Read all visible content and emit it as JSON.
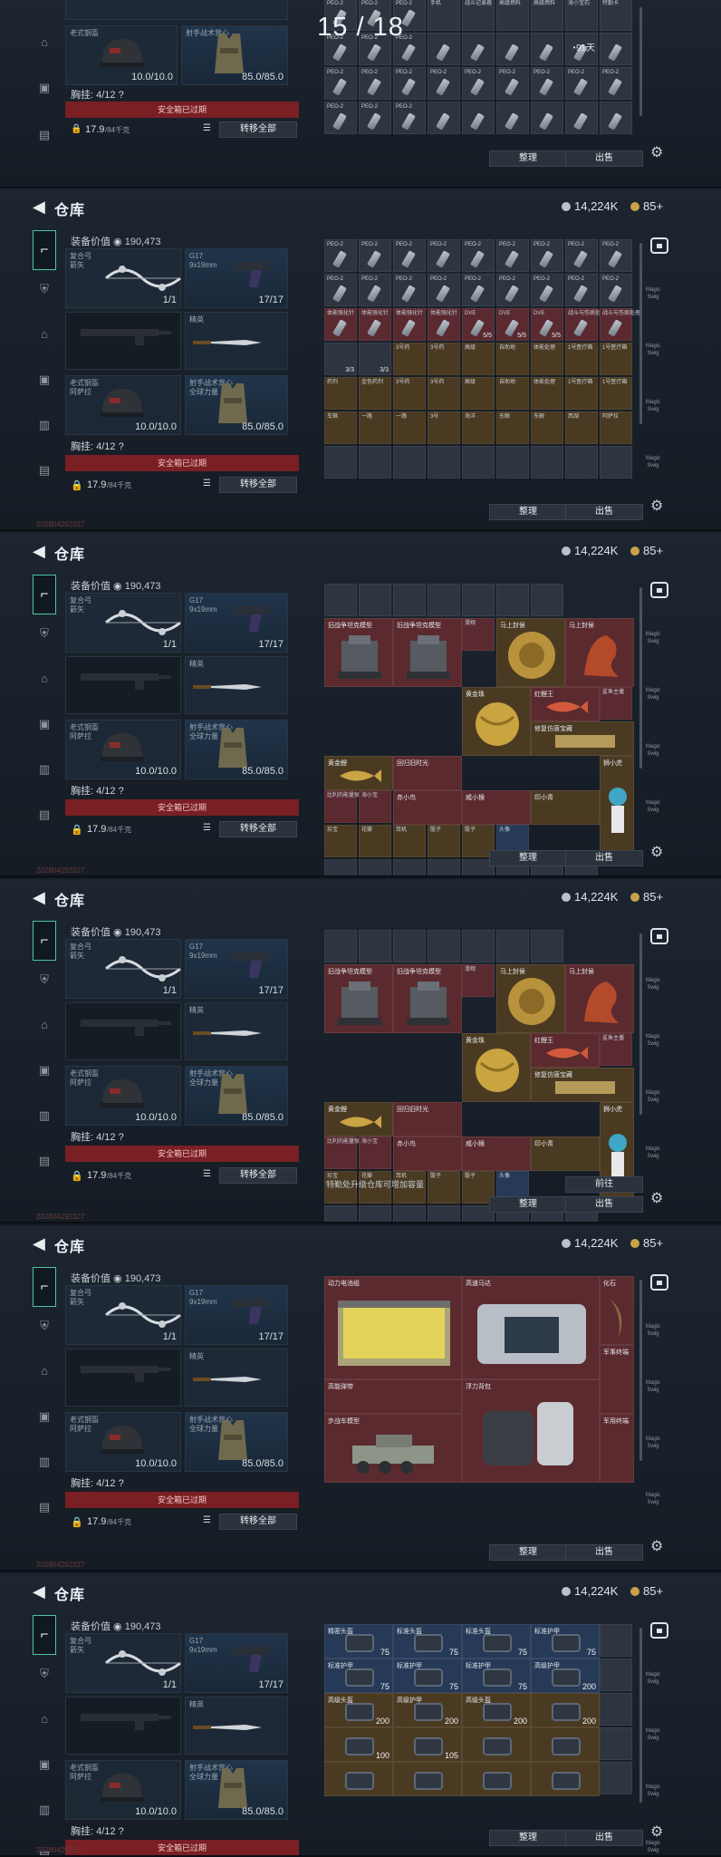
{
  "page_counter": "15 / 18",
  "header": {
    "title": "仓库",
    "currency_a": "14,224K",
    "currency_b": "85+"
  },
  "equipment": {
    "value_label": "装备价值",
    "value": "190,473",
    "bow": {
      "name": "复合弓",
      "sub": "箭矢",
      "count": "1/1"
    },
    "pistol": {
      "name": "G17",
      "sub": "9x19mm",
      "count": "17/17"
    },
    "knife": {
      "name": "精英"
    },
    "helmet": {
      "name": "老式钢盔",
      "sub": "阿萨拉",
      "durability": "10.0/10.0"
    },
    "armor": {
      "name": "射手战术背心",
      "sub": "全球力量",
      "durability": "85.0/85.0"
    },
    "chest_rig": "胸挂: 4/12 ?",
    "safebox": "安全箱已过期",
    "capacity": "17.9",
    "capacity_unit": "/84千克",
    "transfer_all": "转移全部"
  },
  "actions": {
    "sort": "整理",
    "sell": "出售",
    "goto": "前往"
  },
  "hint_text": "特勤处升级仓库可增加容量",
  "top_row_labels": [
    "PEO-2",
    "PEO-2",
    "PEO-2",
    "手机",
    "战斗记录器",
    "高级燃料",
    "高级燃料",
    "海小宝石",
    "特勤卡"
  ],
  "timer": "91天",
  "ammo_label": "PEO-2",
  "row3_labels": [
    "体能强化针",
    "体能强化针",
    "体能强化针",
    "体能强化针",
    "DVE",
    "DVE",
    "DVE",
    "战斗与伤病处理",
    "战斗与伤病处理"
  ],
  "row3_counts": [
    "",
    "",
    "",
    "",
    "5/5",
    "5/5",
    "5/5",
    "",
    ""
  ],
  "small_counts": [
    "3/3",
    "3/3"
  ],
  "row4_labels": [
    "药剂",
    "金色药剂",
    "3号药",
    "3号药",
    "高级",
    "自助地",
    "体能处理",
    "1号医疗箱",
    "1号医疗箱"
  ],
  "row5_labels": [
    "车辆",
    "一路",
    "一路",
    "3号",
    "海洋",
    "东鲸",
    "东鲸",
    "西湖",
    "阿萨拉"
  ],
  "collectibles": [
    "旧战争坦克模型",
    "旧战争坦克模型",
    "滑翔",
    "马上封侯",
    "马上封侯",
    "黄金珠",
    "红鲤王",
    "鲨鱼主播",
    "黄金鲤",
    "回归旧时光",
    "哈尔 达金花",
    "修复仿唐宝藏",
    "比利的能量弹",
    "海小宝",
    "赤小鸟",
    "威小猴",
    "印小青",
    "狮小虎",
    "珍宝",
    "花瓣",
    "耳机",
    "骰子",
    "骰子",
    "头像"
  ],
  "large_items": [
    "动力电池组",
    "高速马达",
    "化石",
    "高能弹带",
    "浮力背包",
    "军事终端",
    "步战车模型",
    "军用终端",
    "军用终端"
  ],
  "tech_labels": [
    "精密头盔",
    "标准头盔",
    "标准头盔",
    "标准护甲",
    "标准护甲",
    "标准护甲",
    "标准护甲",
    "高级护甲",
    "高级头盔",
    "高级护甲",
    "高级头盔"
  ],
  "tech_values": [
    "75",
    "75",
    "75",
    "75",
    "75",
    "75",
    "75",
    "200",
    "200",
    "200",
    "200",
    "200",
    "100",
    "105"
  ],
  "right_labels": [
    "Magic Swig",
    "Magic Swig",
    "Magic Swig",
    "Magic Swig"
  ],
  "watermark": "202804292327"
}
